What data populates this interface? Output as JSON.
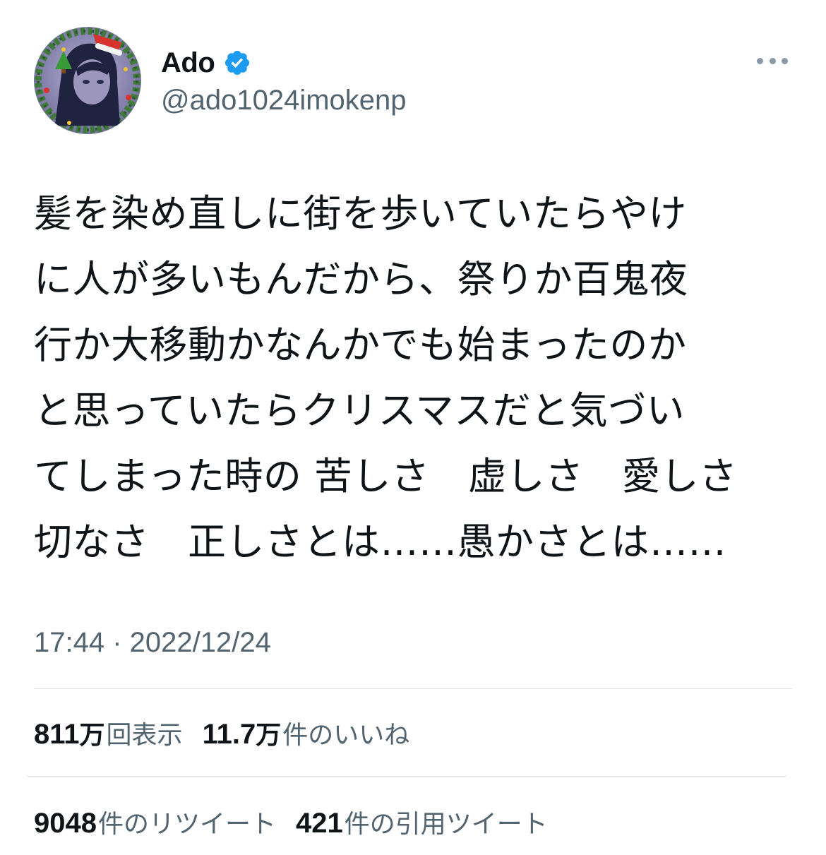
{
  "colors": {
    "text_primary": "#0f1419",
    "text_secondary": "#536471",
    "verified_blue": "#1d9bf0",
    "divider": "#dadfe3"
  },
  "author": {
    "display_name": "Ado",
    "handle": "@ado1024imokenp",
    "verified_icon": "verified-badge-icon",
    "avatar_icon": "avatar-image"
  },
  "tweet": {
    "text_lines": [
      "髪を染め直しに街を歩いていたらやけ",
      "に人が多いもんだから、祭りか百鬼夜",
      "行か大移動かなんかでも始まったのか",
      "と思っていたらクリスマスだと気づい",
      "てしまった時の 苦しさ　虚しさ　愛しさ",
      "切なさ　正しさとは……愚かさとは……"
    ],
    "timestamp": "17:44 · 2022/12/24"
  },
  "stats": {
    "views": {
      "number": "811",
      "unit": "万",
      "label": "回表示"
    },
    "likes": {
      "number": "11.7",
      "unit": "万",
      "label": "件のいいね"
    },
    "retweets": {
      "number": "9048",
      "label": "件のリツイート"
    },
    "quotes": {
      "number": "421",
      "label": "件の引用ツイート"
    }
  },
  "menu": {
    "more_icon": "more-options-icon"
  }
}
